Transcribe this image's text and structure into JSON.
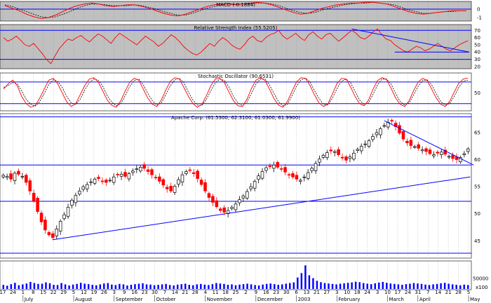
{
  "panels": {
    "macd": {
      "title": "MACD (-0.1884)",
      "y_ticks": [
        "0",
        "-1"
      ],
      "y_tick_values": [
        0,
        -1
      ],
      "ylim": [
        -1.4,
        0.9
      ]
    },
    "rsi": {
      "title": "Relative Strength Index (55.5205)",
      "y_ticks": [
        "70",
        "60",
        "50",
        "40",
        "30",
        "20"
      ],
      "y_tick_values": [
        70,
        60,
        50,
        40,
        30,
        20
      ],
      "ylim": [
        17,
        78
      ],
      "guide_levels": [
        70,
        30
      ]
    },
    "stoch": {
      "title": "Stochastic Oscillator (90.6531)",
      "y_ticks": [
        "50"
      ],
      "y_tick_values": [
        50
      ],
      "ylim": [
        0,
        105
      ],
      "guide_levels": [
        80,
        20
      ]
    },
    "price": {
      "title": "Apache Corp. (61.5300, 62.3100, 61.0300, 61.9900)",
      "y_ticks": [
        "65",
        "60",
        "55",
        "50",
        "45"
      ],
      "y_tick_values": [
        65,
        60,
        55,
        50,
        45
      ],
      "ylim": [
        41.8,
        68.5
      ],
      "support_levels": [
        52.3,
        59.0,
        67.9,
        42.7
      ]
    },
    "volume": {
      "y_ticks": [
        "50000",
        "x100"
      ],
      "tick_value": 50000,
      "ylim": [
        0,
        130000
      ]
    }
  },
  "x_axis": {
    "day_labels": [
      "17",
      "24",
      "1",
      "8",
      "15",
      "22",
      "29",
      "5",
      "12",
      "19",
      "26",
      "3",
      "9",
      "16",
      "23",
      "30",
      "7",
      "14",
      "21",
      "28",
      "4",
      "11",
      "18",
      "25",
      "2",
      "9",
      "16",
      "23",
      "30",
      "6",
      "13",
      "21",
      "27",
      "3",
      "10",
      "18",
      "24",
      "3",
      "10",
      "17",
      "24",
      "31",
      "7",
      "14",
      "21",
      "28",
      "5"
    ],
    "month_labels": [
      "July",
      "August",
      "September",
      "October",
      "November",
      "December",
      "2003",
      "February",
      "March",
      "April",
      "May"
    ]
  },
  "colors": {
    "up": "#000000",
    "down": "#ff0000",
    "indicator": "#ff0000",
    "signal": "#000000",
    "guide": "#0000ff",
    "panel_bg": "#c0c0c0",
    "grid": "#808080",
    "trend": "#0000ff"
  },
  "chart_data": [
    {
      "type": "candlestick",
      "title": "Apache Corp. (61.5300, 62.3100, 61.0300, 61.9900)",
      "last_bar": {
        "open": 61.53,
        "high": 62.31,
        "low": 61.03,
        "close": 61.99
      },
      "ylim": [
        41.8,
        68.5
      ],
      "series": [
        {
          "values": [
            57.1,
            56.9,
            56.4,
            57.5,
            57.3,
            56.9,
            55.8,
            54.2,
            52.4,
            50.4,
            48.5,
            47.0,
            46.1,
            45.6,
            47.2,
            48.6,
            49.8,
            51.2,
            52.5,
            53.4,
            54.2,
            55.0,
            55.4,
            55.9,
            56.4,
            56.5,
            56.0,
            55.8,
            56.2,
            56.8,
            57.2,
            57.3,
            56.9,
            57.4,
            57.9,
            58.3,
            58.6,
            58.4,
            57.8,
            57.2,
            56.6,
            56.0,
            55.3,
            54.6,
            54.2,
            55.1,
            56.3,
            57.2,
            57.8,
            58.0,
            57.4,
            56.5,
            55.4,
            54.2,
            53.0,
            52.1,
            51.3,
            50.6,
            50.3,
            50.6,
            51.2,
            51.8,
            52.6,
            53.3,
            54.1,
            55.0,
            56.0,
            57.0,
            57.8,
            58.5,
            58.8,
            59.0,
            58.6,
            58.2,
            57.7,
            57.2,
            56.8,
            56.4,
            56.2,
            56.8,
            57.6,
            58.4,
            59.3,
            60.1,
            60.8,
            61.3,
            61.6,
            61.5,
            60.9,
            60.3,
            59.9,
            60.5,
            61.2,
            61.9,
            62.5,
            62.9,
            63.5,
            64.3,
            65.0,
            65.7,
            66.3,
            66.9,
            67.2,
            66.1,
            64.9,
            63.8,
            63.1,
            62.6,
            62.4,
            62.1,
            61.8,
            61.5,
            61.1,
            60.9,
            61.2,
            61.4,
            61.0,
            60.6,
            60.2,
            60.0,
            60.4,
            61.1,
            61.99
          ]
        }
      ]
    },
    {
      "type": "bar",
      "title": "Volume",
      "ylim": [
        0,
        130000
      ],
      "series": [
        {
          "values": [
            22000,
            18000,
            25000,
            31000,
            20000,
            24000,
            28000,
            35000,
            30000,
            26000,
            27000,
            33000,
            29000,
            22000,
            21000,
            30000,
            24000,
            19000,
            23000,
            26000,
            31000,
            27000,
            25000,
            22000,
            20000,
            24000,
            28000,
            30000,
            23000,
            21000,
            26000,
            24000,
            19000,
            22000,
            25000,
            27000,
            29000,
            24000,
            23000,
            20000,
            22000,
            24000,
            26000,
            21000,
            19000,
            23000,
            25000,
            27000,
            22000,
            20000,
            24000,
            26000,
            23000,
            21000,
            25000,
            30000,
            28000,
            26000,
            22000,
            24000,
            20000,
            23000,
            25000,
            27000,
            24000,
            21000,
            19000,
            23000,
            26000,
            28000,
            25000,
            22000,
            24000,
            27000,
            30000,
            33000,
            55000,
            75000,
            110000,
            65000,
            52000,
            40000,
            34000,
            30000,
            28000,
            26000,
            24000,
            27000,
            29000,
            31000,
            33000,
            36000,
            34000,
            30000,
            27000,
            25000,
            29000,
            32000,
            35000,
            31000,
            28000,
            26000,
            24000,
            22000,
            25000,
            27000,
            30000,
            28000,
            26000,
            23000,
            21000,
            24000,
            26000,
            29000,
            31000,
            27000,
            24000,
            22000,
            20000,
            23000,
            21000
          ]
        }
      ]
    },
    {
      "type": "line",
      "title": "MACD (-0.1884)",
      "ylim": [
        -1.4,
        0.9
      ],
      "series": [
        {
          "values": [
            0.4,
            0.1,
            -0.2,
            -0.6,
            -0.9,
            -1.1,
            -1.0,
            -0.7,
            -0.3,
            0.1,
            0.4,
            0.6,
            0.7,
            0.6,
            0.4,
            0.3,
            0.4,
            0.5,
            0.5,
            0.3,
            0.1,
            -0.2,
            -0.5,
            -0.7,
            -0.8,
            -0.6,
            -0.3,
            0.0,
            0.3,
            0.5,
            0.6,
            0.6,
            0.5,
            0.6,
            0.7,
            0.8,
            0.7,
            0.5,
            0.2,
            -0.1,
            -0.4,
            -0.6,
            -0.5,
            -0.2,
            0.1,
            0.3,
            0.5,
            0.6,
            0.7,
            0.7,
            0.8,
            0.8,
            0.7,
            0.6,
            0.3,
            0.0,
            -0.3,
            -0.5,
            -0.6,
            -0.5,
            -0.4,
            -0.3,
            -0.2,
            -0.2,
            -0.19
          ]
        },
        {
          "values": [
            0.5,
            0.3,
            0.0,
            -0.3,
            -0.6,
            -0.9,
            -1.0,
            -0.9,
            -0.6,
            -0.3,
            0.1,
            0.4,
            0.6,
            0.6,
            0.5,
            0.4,
            0.4,
            0.4,
            0.5,
            0.4,
            0.2,
            0.0,
            -0.3,
            -0.5,
            -0.7,
            -0.7,
            -0.5,
            -0.2,
            0.1,
            0.3,
            0.5,
            0.6,
            0.6,
            0.6,
            0.6,
            0.7,
            0.7,
            0.6,
            0.4,
            0.1,
            -0.2,
            -0.4,
            -0.5,
            -0.4,
            -0.1,
            0.1,
            0.3,
            0.5,
            0.6,
            0.7,
            0.7,
            0.8,
            0.7,
            0.6,
            0.5,
            0.2,
            -0.1,
            -0.3,
            -0.5,
            -0.5,
            -0.4,
            -0.3,
            -0.3,
            -0.2,
            -0.2
          ]
        }
      ]
    },
    {
      "type": "line",
      "title": "Relative Strength Index (55.5205)",
      "ylim": [
        17,
        78
      ],
      "series": [
        {
          "values": [
            60,
            55,
            58,
            62,
            56,
            50,
            48,
            52,
            45,
            38,
            30,
            24,
            35,
            45,
            52,
            58,
            56,
            60,
            63,
            58,
            54,
            60,
            65,
            62,
            57,
            52,
            60,
            66,
            62,
            58,
            54,
            50,
            56,
            62,
            58,
            54,
            48,
            52,
            58,
            64,
            60,
            54,
            47,
            42,
            38,
            36,
            40,
            46,
            52,
            48,
            55,
            60,
            56,
            50,
            46,
            44,
            50,
            58,
            62,
            56,
            54,
            60,
            64,
            66,
            70,
            62,
            58,
            62,
            66,
            60,
            56,
            64,
            68,
            62,
            58,
            64,
            66,
            60,
            55,
            60,
            65,
            70,
            66,
            60,
            58,
            62,
            68,
            72,
            64,
            58,
            56,
            50,
            46,
            42,
            40,
            44,
            48,
            46,
            42,
            44,
            48,
            52,
            48,
            44,
            42,
            46,
            50,
            53,
            55.52
          ]
        }
      ]
    },
    {
      "type": "line",
      "title": "Stochastic Oscillator (90.6531)",
      "ylim": [
        0,
        105
      ],
      "series": [
        {
          "values": [
            60,
            75,
            85,
            70,
            40,
            20,
            10,
            15,
            35,
            60,
            85,
            90,
            75,
            50,
            25,
            12,
            20,
            45,
            70,
            88,
            92,
            80,
            55,
            30,
            15,
            10,
            28,
            55,
            80,
            90,
            85,
            60,
            35,
            18,
            12,
            30,
            58,
            82,
            92,
            88,
            65,
            40,
            20,
            10,
            18,
            42,
            70,
            88,
            90,
            78,
            52,
            28,
            14,
            12,
            32,
            62,
            85,
            92,
            84,
            60,
            34,
            16,
            10,
            26,
            54,
            80,
            92,
            90,
            70,
            44,
            22,
            12,
            20,
            48,
            76,
            90,
            88,
            66,
            40,
            20,
            14,
            30,
            60,
            84,
            92,
            86,
            62,
            36,
            18,
            12,
            28,
            56,
            80,
            90,
            84,
            60,
            36,
            18,
            12,
            26,
            52,
            76,
            88,
            90.65
          ]
        },
        {
          "values": [
            65,
            70,
            78,
            75,
            55,
            32,
            18,
            13,
            25,
            48,
            72,
            86,
            82,
            65,
            40,
            22,
            18,
            32,
            58,
            78,
            88,
            85,
            68,
            42,
            24,
            14,
            20,
            42,
            68,
            84,
            88,
            72,
            48,
            28,
            16,
            22,
            45,
            70,
            86,
            90,
            78,
            52,
            30,
            16,
            15,
            32,
            56,
            78,
            88,
            84,
            66,
            40,
            22,
            14,
            24,
            48,
            74,
            88,
            88,
            72,
            48,
            26,
            14,
            18,
            42,
            68,
            86,
            90,
            80,
            56,
            34,
            18,
            16,
            36,
            62,
            82,
            88,
            78,
            54,
            30,
            18,
            22,
            46,
            72,
            88,
            88,
            74,
            48,
            26,
            16,
            22,
            44,
            68,
            84,
            86,
            72,
            48,
            26,
            16,
            20,
            40,
            64,
            82,
            85
          ]
        }
      ]
    }
  ]
}
